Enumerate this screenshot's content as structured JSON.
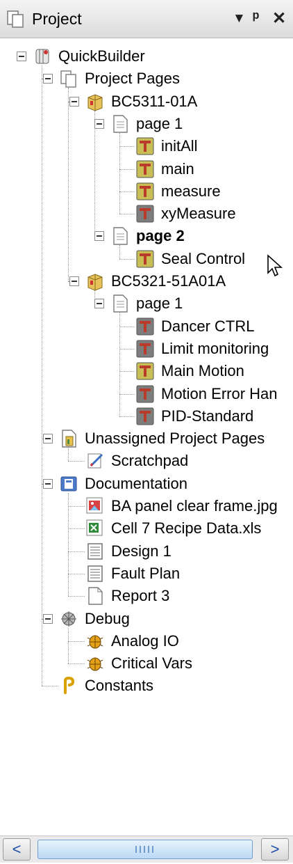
{
  "panel": {
    "title": "Project",
    "icon": "project-pages-icon",
    "buttons": [
      "chevron-down-icon",
      "pin-icon",
      "close-icon"
    ]
  },
  "tree": {
    "nodes": [
      {
        "label": "QuickBuilder",
        "icon": "quickbuilder-icon",
        "level": 0,
        "expanded": true
      },
      {
        "label": "Project Pages",
        "icon": "pages-icon",
        "level": 1,
        "expanded": true
      },
      {
        "label": "BC5311-01A",
        "icon": "controller-icon",
        "level": 2,
        "expanded": true
      },
      {
        "label": "page 1",
        "icon": "page-icon",
        "level": 3,
        "expanded": true
      },
      {
        "label": "initAll",
        "icon": "function-block-icon",
        "level": 4
      },
      {
        "label": "main",
        "icon": "function-block-icon",
        "level": 4
      },
      {
        "label": "measure",
        "icon": "function-block-icon",
        "level": 4
      },
      {
        "label": "xyMeasure",
        "icon": "function-block-gray-icon",
        "level": 4
      },
      {
        "label": "page 2",
        "icon": "page-icon",
        "level": 3,
        "expanded": true,
        "bold": true
      },
      {
        "label": "Seal Control",
        "icon": "function-block-icon",
        "level": 4
      },
      {
        "label": "BC5321-51A01A",
        "icon": "controller-icon",
        "level": 2,
        "expanded": true
      },
      {
        "label": "page 1",
        "icon": "page-icon",
        "level": 3,
        "expanded": true
      },
      {
        "label": "Dancer CTRL",
        "icon": "function-block-gray-icon",
        "level": 4
      },
      {
        "label": "Limit monitoring",
        "icon": "function-block-gray-icon",
        "level": 4
      },
      {
        "label": "Main Motion",
        "icon": "function-block-icon",
        "level": 4
      },
      {
        "label": "Motion Error Han",
        "icon": "function-block-gray-icon",
        "level": 4
      },
      {
        "label": "PID-Standard",
        "icon": "function-block-gray-icon",
        "level": 4
      },
      {
        "label": "Unassigned Project Pages",
        "icon": "unassigned-pages-icon",
        "level": 1,
        "expanded": true
      },
      {
        "label": "Scratchpad",
        "icon": "scratchpad-icon",
        "level": 2
      },
      {
        "label": "Documentation",
        "icon": "documentation-icon",
        "level": 1,
        "expanded": true
      },
      {
        "label": "BA panel clear frame.jpg",
        "icon": "image-file-icon",
        "level": 2
      },
      {
        "label": "Cell 7 Recipe Data.xls",
        "icon": "excel-file-icon",
        "level": 2
      },
      {
        "label": "Design 1",
        "icon": "form-icon",
        "level": 2
      },
      {
        "label": "Fault Plan",
        "icon": "form-icon",
        "level": 2
      },
      {
        "label": "Report 3",
        "icon": "report-icon",
        "level": 2
      },
      {
        "label": "Debug",
        "icon": "debug-icon",
        "level": 1,
        "expanded": true
      },
      {
        "label": "Analog IO",
        "icon": "bug-icon",
        "level": 2
      },
      {
        "label": "Critical Vars",
        "icon": "bug-icon",
        "level": 2
      },
      {
        "label": "Constants",
        "icon": "constants-icon",
        "level": 1
      }
    ]
  },
  "scrollbar": {
    "left_icon": "scroll-left-icon",
    "right_icon": "scroll-right-icon",
    "left_glyph": "<",
    "right_glyph": ">"
  },
  "colors": {
    "fb_active": "#c8be55",
    "fb_gray": "#7d7d7d",
    "fb_accent": "#b93b2a",
    "selection_blue": "#6f9dd0"
  }
}
